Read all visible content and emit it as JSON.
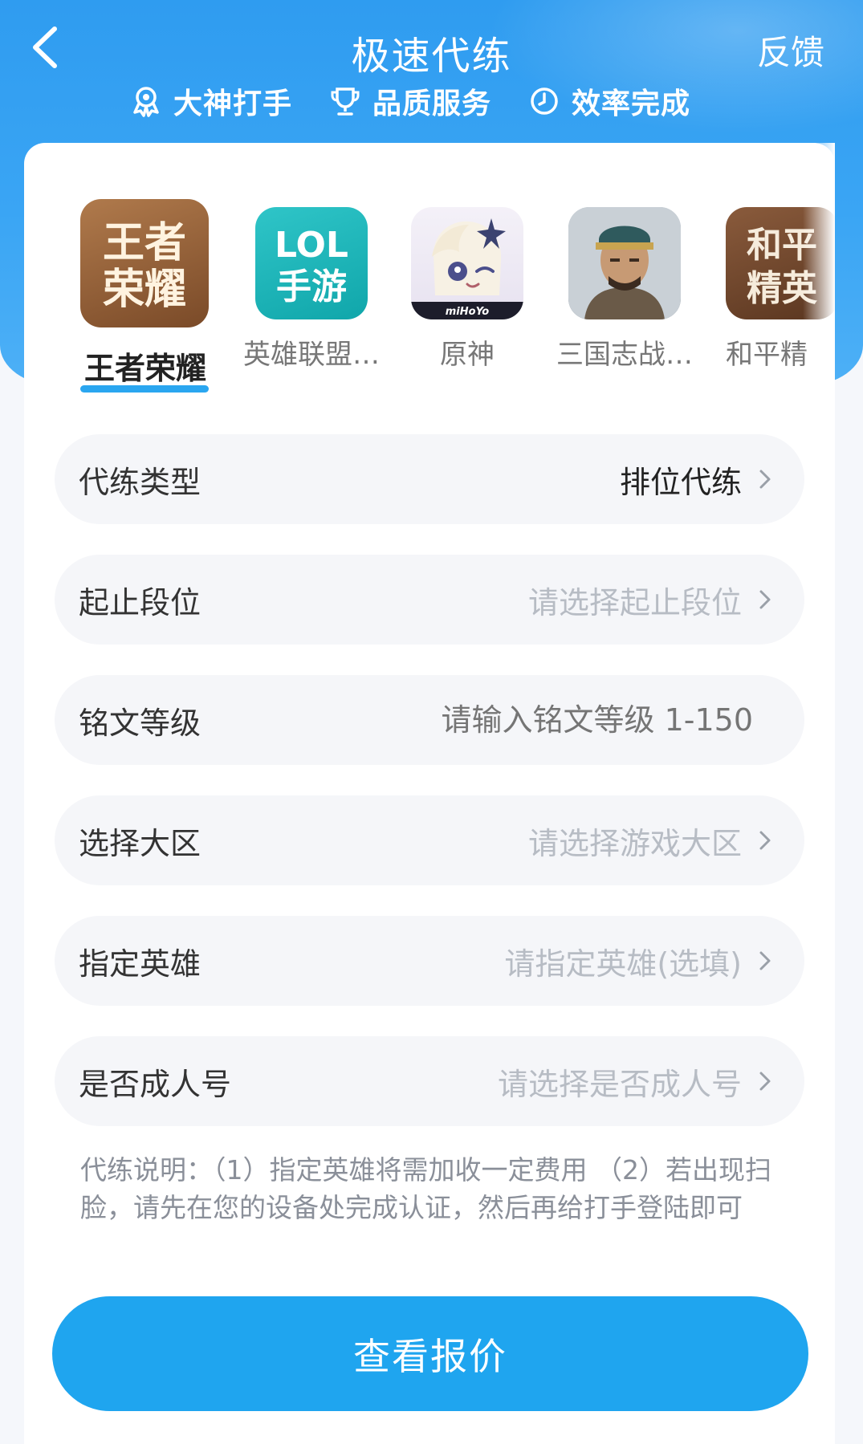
{
  "header": {
    "title": "极速代练",
    "right_action": "反馈",
    "features": [
      {
        "icon": "medal-icon",
        "label": "大神打手"
      },
      {
        "icon": "trophy-icon",
        "label": "品质服务"
      },
      {
        "icon": "clock-icon",
        "label": "效率完成"
      }
    ]
  },
  "games": {
    "selected": "王者荣耀",
    "items": [
      {
        "label": "王者荣耀",
        "icon_text": "王者荣耀",
        "icon": "honor-of-kings-icon"
      },
      {
        "label": "英雄联盟…",
        "icon_text": "LOL手游",
        "icon": "lol-mobile-icon"
      },
      {
        "label": "原神",
        "icon_text": "miHoYo",
        "icon": "genshin-icon"
      },
      {
        "label": "三国志战…",
        "icon_text": "",
        "icon": "sanguozhi-icon"
      },
      {
        "label": "和平精",
        "icon_text": "和平精英",
        "icon": "peace-elite-icon"
      }
    ]
  },
  "form": {
    "rows": [
      {
        "label": "代练类型",
        "value": "排位代练"
      },
      {
        "label": "起止段位",
        "placeholder": "请选择起止段位"
      },
      {
        "label": "铭文等级",
        "placeholder": "请输入铭文等级 1-150"
      },
      {
        "label": "选择大区",
        "placeholder": "请选择游戏大区"
      },
      {
        "label": "指定英雄",
        "placeholder": "请指定英雄(选填)"
      },
      {
        "label": "是否成人号",
        "placeholder": "请选择是否成人号"
      }
    ]
  },
  "note": "代练说明：（1）指定英雄将需加收一定费用 （2）若出现扫脸，请先在您的设备处完成认证，然后再给打手登陆即可",
  "submit_label": "查看报价",
  "colors": {
    "primary": "#1fa5ef",
    "header_gradient_top": "#2f9cf0"
  }
}
